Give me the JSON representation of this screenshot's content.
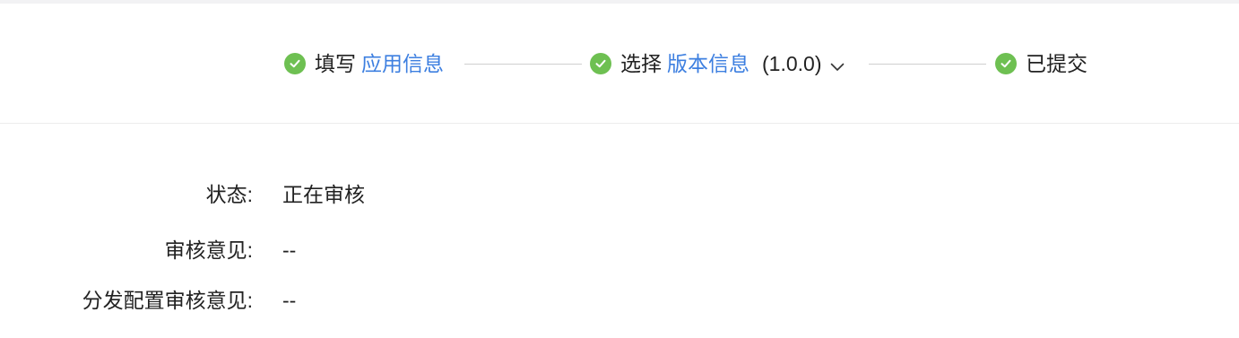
{
  "steps": [
    {
      "prefix": "填写",
      "link": "应用信息",
      "status": "done"
    },
    {
      "prefix": "选择",
      "link": "版本信息",
      "version": "(1.0.0)",
      "status": "done"
    },
    {
      "prefix": "已提交",
      "status": "done"
    }
  ],
  "info": {
    "status_label": "状态:",
    "status_value": "正在审核",
    "review_label": "审核意见:",
    "review_value": "--",
    "dist_review_label": "分发配置审核意见:",
    "dist_review_value": "--"
  },
  "colors": {
    "check": "#6ec052",
    "link": "#3d7fe0",
    "connector": "#cfcfcf"
  }
}
